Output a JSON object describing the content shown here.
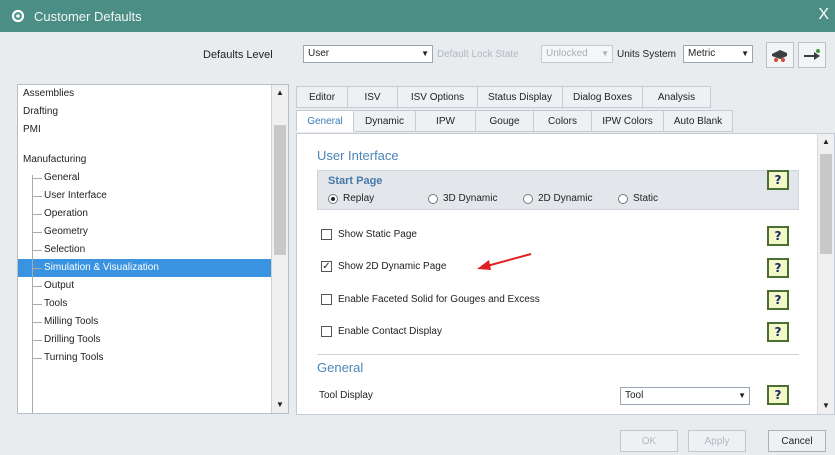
{
  "window": {
    "title": "Customer Defaults",
    "close": "X"
  },
  "toolbar": {
    "defaults_level_label": "Defaults Level",
    "defaults_level_value": "User",
    "lock_state_label": "Default Lock State",
    "lock_state_value": "Unlocked",
    "units_label": "Units System",
    "units_value": "Metric"
  },
  "tree": {
    "items": [
      {
        "label": "Assemblies"
      },
      {
        "label": "Drafting"
      },
      {
        "label": "PMI"
      },
      {
        "label": "Manufacturing"
      },
      {
        "label": "General"
      },
      {
        "label": "User Interface"
      },
      {
        "label": "Operation"
      },
      {
        "label": "Geometry"
      },
      {
        "label": "Selection"
      },
      {
        "label": "Simulation & Visualization"
      },
      {
        "label": "Output"
      },
      {
        "label": "Tools"
      },
      {
        "label": "Milling Tools"
      },
      {
        "label": "Drilling Tools"
      },
      {
        "label": "Turning Tools"
      }
    ],
    "selected_index": 9
  },
  "tabs_row1": [
    "Editor",
    "ISV",
    "ISV Options",
    "Status Display",
    "Dialog Boxes",
    "Analysis"
  ],
  "tabs_row2": [
    "General",
    "Dynamic",
    "IPW",
    "Gouge",
    "Colors",
    "IPW Colors",
    "Auto Blank"
  ],
  "content": {
    "section_ui": "User Interface",
    "start_page": {
      "title": "Start Page",
      "options": [
        "Replay",
        "3D Dynamic",
        "2D Dynamic",
        "Static"
      ],
      "selected": 0
    },
    "checks": [
      {
        "label": "Show Static Page",
        "checked": false
      },
      {
        "label": "Show 2D Dynamic Page",
        "checked": true
      },
      {
        "label": "Enable Faceted Solid for Gouges and Excess",
        "checked": false
      },
      {
        "label": "Enable Contact Display",
        "checked": false
      }
    ],
    "section_general": "General",
    "tool_display_label": "Tool Display",
    "tool_display_value": "Tool",
    "help_glyph": "?"
  },
  "buttons": {
    "ok": "OK",
    "apply": "Apply",
    "cancel": "Cancel"
  }
}
